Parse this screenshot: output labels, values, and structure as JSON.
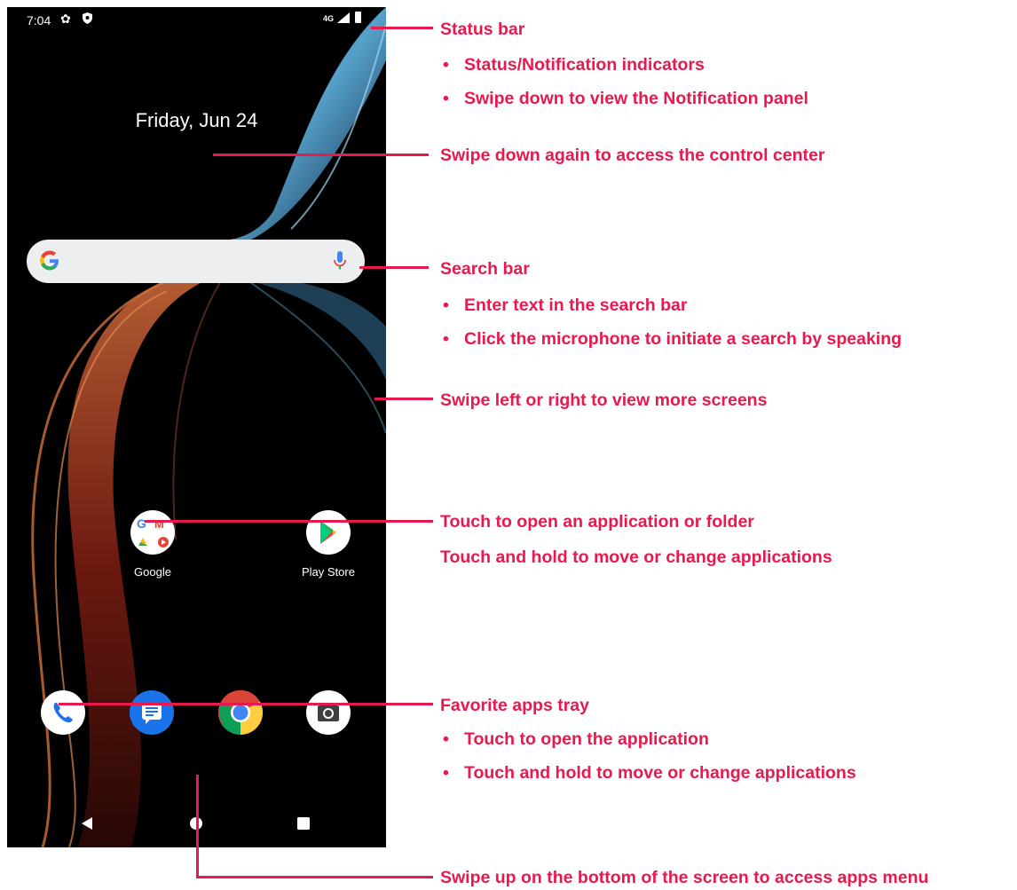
{
  "status_bar": {
    "time": "7:04",
    "network": "4G"
  },
  "home": {
    "date": "Friday, Jun 24",
    "apps": [
      {
        "label": "Google"
      },
      {
        "label": "Play Store"
      }
    ]
  },
  "annotations": {
    "status_bar": "Status bar",
    "status_bullets": [
      "Status/Notification indicators",
      "Swipe down to view the Notification panel"
    ],
    "control_center": "Swipe down again to access the control center",
    "search_bar": "Search bar",
    "search_bullets": [
      "Enter text in the search bar",
      "Click the microphone to initiate a search by speaking"
    ],
    "swipe_screens": "Swipe left or right to view more screens",
    "open_app": "Touch to open an application or folder",
    "move_app": "Touch and hold to move or change applications",
    "favorites": "Favorite apps tray",
    "favorites_bullets": [
      "Touch to open the application",
      "Touch and hold to move or change applications"
    ],
    "apps_menu": "Swipe up on the bottom of the screen to access apps menu"
  },
  "colors": {
    "annotation": "#e8194e",
    "search_bg": "#eceef0"
  }
}
